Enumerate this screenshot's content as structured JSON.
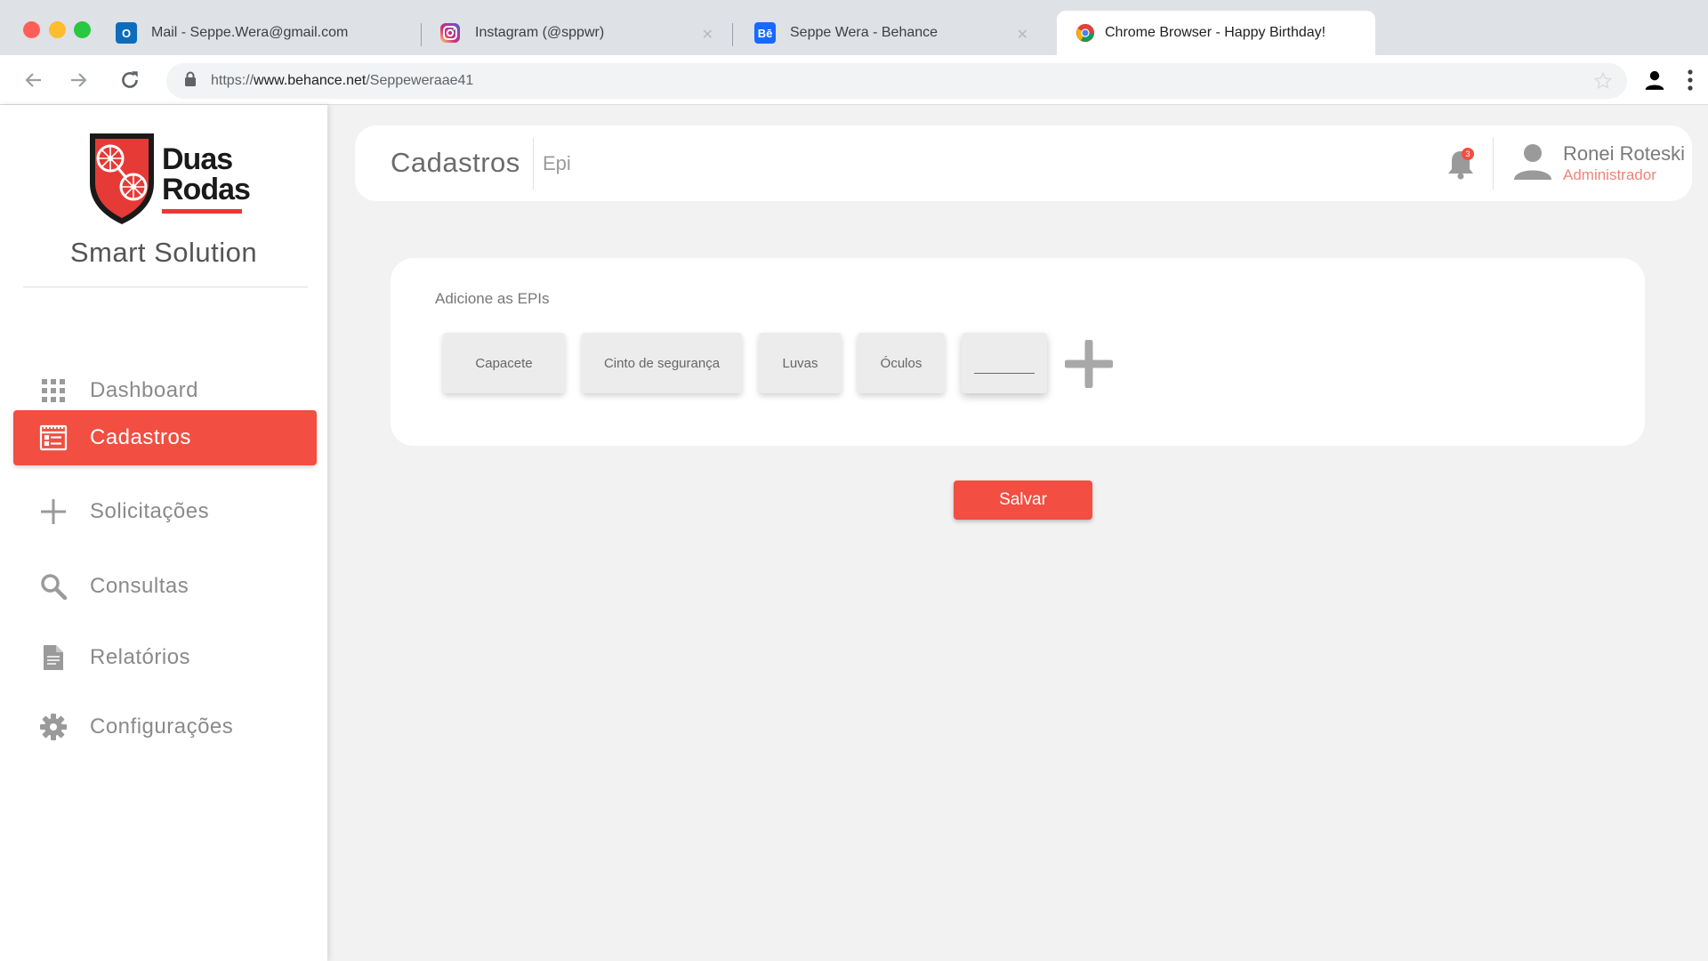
{
  "browser": {
    "tabs": [
      {
        "title": "Mail - Seppe.Wera@gmail.com",
        "icon": "outlook-icon",
        "active": false
      },
      {
        "title": "Instagram (@sppwr)",
        "icon": "instagram-icon",
        "active": false
      },
      {
        "title": "Seppe Wera - Behance",
        "icon": "behance-icon",
        "active": false
      },
      {
        "title": "Chrome Browser - Happy Birthday!",
        "icon": "chrome-icon",
        "active": true
      }
    ],
    "url": {
      "scheme": "https://",
      "host": "www.behance.net",
      "path": "/Seppeweraae41"
    },
    "behance_favicon_text": "Bē",
    "outlook_favicon_text": "O"
  },
  "brand": {
    "logo_line1": "Duas",
    "logo_line2": "Rodas",
    "name": "Smart Solution",
    "accent_color": "#f24e42"
  },
  "sidebar": {
    "items": [
      {
        "label": "Dashboard",
        "icon": "grid-icon",
        "active": false
      },
      {
        "label": "Cadastros",
        "icon": "form-icon",
        "active": true
      },
      {
        "label": "Solicitações",
        "icon": "plus-icon",
        "active": false
      },
      {
        "label": "Consultas",
        "icon": "search-icon",
        "active": false
      },
      {
        "label": "Relatórios",
        "icon": "document-icon",
        "active": false
      },
      {
        "label": "Configurações",
        "icon": "gear-icon",
        "active": false
      }
    ]
  },
  "header": {
    "title": "Cadastros",
    "subtitle": "Epi",
    "notifications_count": "3",
    "user": {
      "name": "Ronei Roteski",
      "role": "Administrador"
    }
  },
  "epi": {
    "label": "Adicione as EPIs",
    "items": [
      "Capacete",
      "Cinto de segurança",
      "Luvas",
      "Óculos"
    ],
    "new_item_value": ""
  },
  "actions": {
    "save_label": "Salvar"
  }
}
